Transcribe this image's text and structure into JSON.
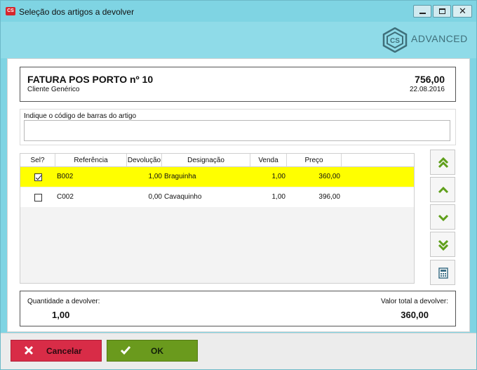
{
  "window": {
    "title": "Seleção dos artigos a devolver",
    "app_icon_label": "CS",
    "logo_text": "ADVANCED"
  },
  "invoice": {
    "title": "FATURA POS PORTO nº 10",
    "client": "Cliente Genérico",
    "total": "756,00",
    "date": "22.08.2016"
  },
  "barcode": {
    "label": "Indique o código de barras do artigo",
    "value": "",
    "placeholder": ""
  },
  "grid": {
    "columns": [
      "Sel?",
      "Referência",
      "Devolução",
      "Designação",
      "Venda",
      "Preço"
    ],
    "rows": [
      {
        "selected": true,
        "reference": "B002",
        "devolucao": "1,00",
        "designacao": "Braguinha",
        "venda": "1,00",
        "preco": "360,00"
      },
      {
        "selected": false,
        "reference": "C002",
        "devolucao": "0,00",
        "designacao": "Cavaquinho",
        "venda": "1,00",
        "preco": "396,00"
      }
    ]
  },
  "side_buttons": [
    "double-chevron-up-icon",
    "chevron-up-icon",
    "chevron-down-icon",
    "double-chevron-down-icon",
    "calculator-icon"
  ],
  "summary": {
    "qty_label": "Quantidade a devolver:",
    "qty_value": "1,00",
    "total_label": "Valor total a devolver:",
    "total_value": "360,00"
  },
  "buttons": {
    "cancel_label": "Cancelar",
    "ok_label": "OK"
  },
  "colors": {
    "header": "#8fdbe8",
    "selected_row": "#ffff00",
    "cancel": "#d82c47",
    "ok": "#6a9a1d",
    "arrow": "#5f9f1a"
  }
}
